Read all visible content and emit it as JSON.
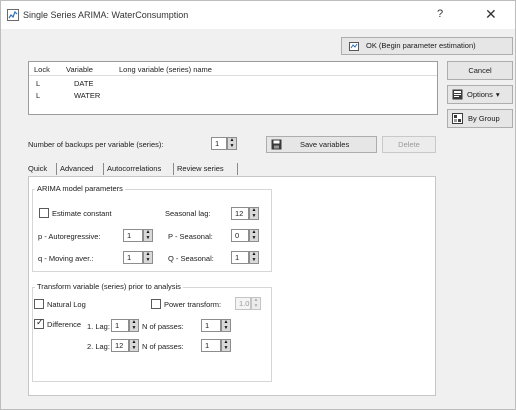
{
  "window": {
    "title": "Single Series ARIMA: WaterConsumption",
    "help_glyph": "?",
    "close_glyph": "✕"
  },
  "buttons": {
    "ok": "OK (Begin parameter estimation)",
    "cancel": "Cancel",
    "options": "Options",
    "options_arrow": "▾",
    "by_group": "By Group",
    "save_variables": "Save variables",
    "delete": "Delete"
  },
  "variable_list": {
    "headers": [
      "Lock",
      "Variable",
      "Long variable (series) name"
    ],
    "rows": [
      {
        "lock": "L",
        "variable": "DATE",
        "long_name": ""
      },
      {
        "lock": "L",
        "variable": "WATER",
        "long_name": ""
      }
    ]
  },
  "backups": {
    "label": "Number of backups per variable (series):",
    "value": "1"
  },
  "tabs": [
    {
      "label": "Quick",
      "active": true
    },
    {
      "label": "Advanced",
      "active": false
    },
    {
      "label": "Autocorrelations",
      "active": false
    },
    {
      "label": "Review series",
      "active": false
    }
  ],
  "arima": {
    "group_title": "ARIMA model parameters",
    "estimate_constant": {
      "label": "Estimate constant",
      "checked": false
    },
    "seasonal_lag": {
      "label": "Seasonal lag:",
      "value": "12"
    },
    "p_autoregressive": {
      "label": "p - Autoregressive:",
      "value": "1"
    },
    "P_seasonal": {
      "label": "P - Seasonal:",
      "value": "0"
    },
    "q_moving_aver": {
      "label": "q - Moving aver.:",
      "value": "1"
    },
    "Q_seasonal": {
      "label": "Q - Seasonal:",
      "value": "1"
    }
  },
  "transform": {
    "group_title": "Transform variable (series) prior to analysis",
    "natural_log": {
      "label": "Natural Log",
      "checked": false
    },
    "power_transform": {
      "label": "Power transform:",
      "checked": false,
      "value": "1.0"
    },
    "difference": {
      "label": "Difference",
      "checked": true
    },
    "lag1": {
      "label": "1. Lag:",
      "value": "1"
    },
    "n_passes1": {
      "label": "N of passes:",
      "value": "1"
    },
    "lag2": {
      "label": "2. Lag:",
      "value": "12"
    },
    "n_passes2": {
      "label": "N of passes:",
      "value": "1"
    }
  },
  "icons": {
    "spin_up": "▲",
    "spin_down": "▼",
    "check": "✓"
  }
}
